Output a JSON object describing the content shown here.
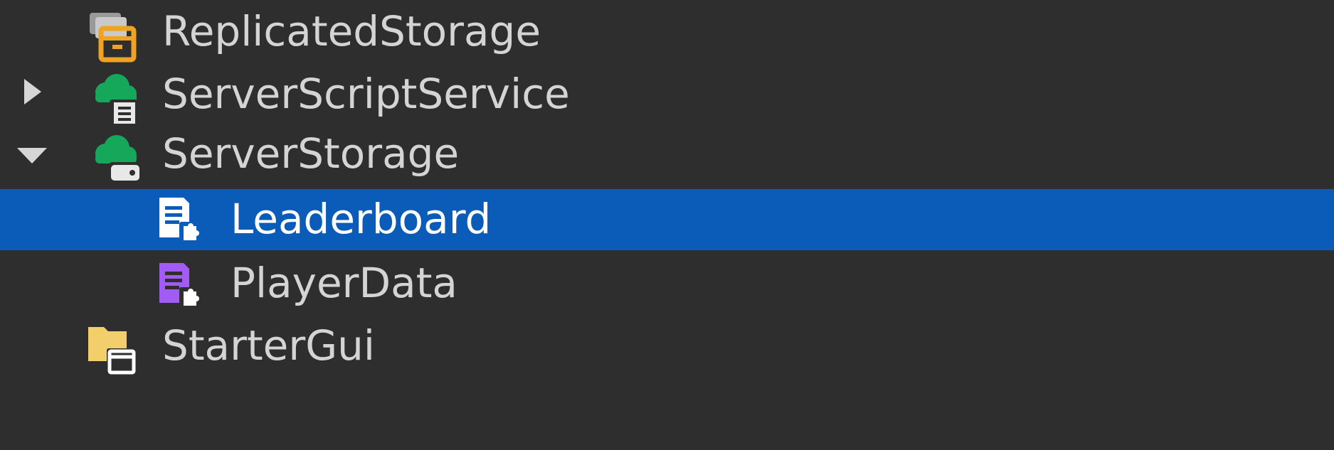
{
  "explorer": {
    "items": [
      {
        "label": "ReplicatedStorage",
        "icon": "replicated-storage-icon",
        "expander": "none",
        "selected": false
      },
      {
        "label": "ServerScriptService",
        "icon": "server-script-service-icon",
        "expander": "collapsed",
        "selected": false
      },
      {
        "label": "ServerStorage",
        "icon": "server-storage-icon",
        "expander": "expanded",
        "selected": false
      },
      {
        "label": "Leaderboard",
        "icon": "module-script-icon",
        "expander": "none",
        "selected": true
      },
      {
        "label": "PlayerData",
        "icon": "module-script-icon",
        "expander": "none",
        "selected": false
      },
      {
        "label": "StarterGui",
        "icon": "starter-gui-icon",
        "expander": "none",
        "selected": false
      }
    ]
  },
  "colors": {
    "background": "#2e2e2e",
    "selection": "#0b5cb8",
    "text": "#d4d4d4",
    "selected_text": "#ffffff",
    "service_green": "#16a85a",
    "storage_orange": "#f0a323",
    "module_purple": "#a35cf3",
    "folder_yellow": "#f3cf6b"
  }
}
